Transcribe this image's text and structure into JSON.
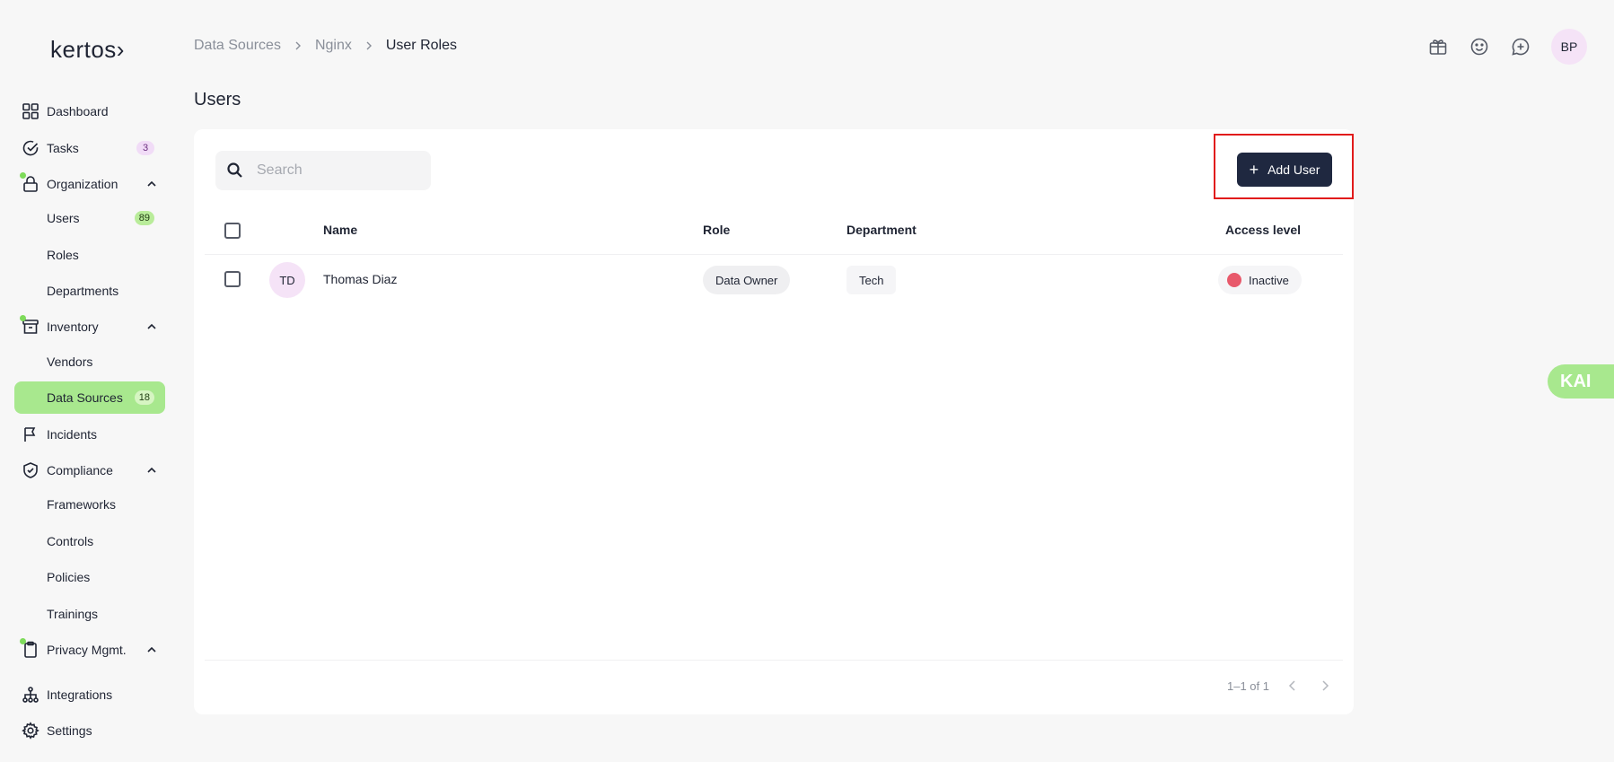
{
  "brand": {
    "logo_text": "kertos›"
  },
  "sidebar": {
    "items": [
      {
        "label": "Dashboard",
        "icon": "dashboard-icon"
      },
      {
        "label": "Tasks",
        "icon": "check-circle-icon",
        "badge": "3"
      },
      {
        "label": "Organization",
        "icon": "lock-icon"
      },
      {
        "label": "Users",
        "badge": "89"
      },
      {
        "label": "Roles"
      },
      {
        "label": "Departments"
      },
      {
        "label": "Inventory",
        "icon": "archive-icon"
      },
      {
        "label": "Vendors"
      },
      {
        "label": "Data Sources",
        "badge": "18",
        "active": true
      },
      {
        "label": "Incidents",
        "icon": "flag-icon"
      },
      {
        "label": "Compliance",
        "icon": "shield-check-icon"
      },
      {
        "label": "Frameworks"
      },
      {
        "label": "Controls"
      },
      {
        "label": "Policies"
      },
      {
        "label": "Trainings"
      },
      {
        "label": "Privacy Mgmt.",
        "icon": "clipboard-icon"
      },
      {
        "label": "Integrations",
        "icon": "network-icon"
      },
      {
        "label": "Settings",
        "icon": "gear-icon"
      }
    ]
  },
  "breadcrumb": [
    "Data Sources",
    "Nginx",
    "User Roles"
  ],
  "page": {
    "title": "Users"
  },
  "header": {
    "avatar_initials": "BP"
  },
  "search": {
    "placeholder": "Search",
    "value": ""
  },
  "toolbar": {
    "add_user_label": "Add User"
  },
  "table": {
    "columns": [
      "Name",
      "Role",
      "Department",
      "Access level"
    ],
    "rows": [
      {
        "initials": "TD",
        "name": "Thomas Diaz",
        "role": "Data Owner",
        "department": "Tech",
        "access_level": "Inactive"
      }
    ]
  },
  "pagination": {
    "range": "1–1 of 1"
  },
  "assistant": {
    "label": "KAI"
  },
  "colors": {
    "accent": "#a8e88e",
    "primary_button": "#1f2840",
    "inactive_dot": "#e8596b",
    "highlight": "#e11b1b"
  }
}
